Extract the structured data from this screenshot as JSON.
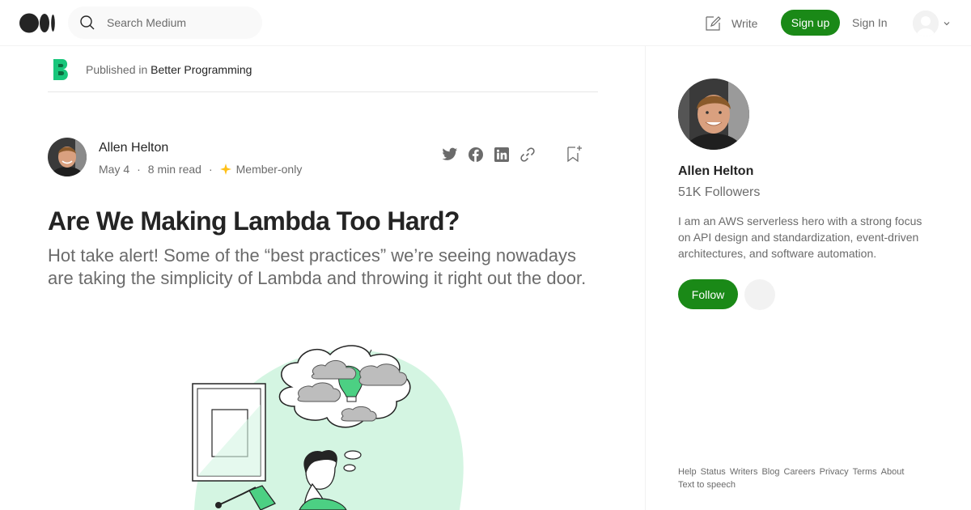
{
  "header": {
    "search_placeholder": "Search Medium",
    "write_label": "Write",
    "signup_label": "Sign up",
    "signin_label": "Sign In"
  },
  "publication": {
    "prefix": "Published in ",
    "name": "Better Programming"
  },
  "article": {
    "author": "Allen Helton",
    "date": "May 4",
    "read_time": "8 min read",
    "member_label": "Member-only",
    "title": "Are We Making Lambda Too Hard?",
    "subtitle": "Hot take alert! Some of the “best practices” we’re seeing nowadays are taking the simplicity of Lambda and throwing it right out the door."
  },
  "sidebar": {
    "name": "Allen Helton",
    "followers": "51K Followers",
    "bio": "I am an AWS serverless hero with a strong focus on API design and standardization, event-driven architectures, and software automation.",
    "follow_label": "Follow"
  },
  "footer": {
    "links": [
      "Help",
      "Status",
      "Writers",
      "Blog",
      "Careers",
      "Privacy",
      "Terms",
      "About",
      "Text to speech"
    ]
  },
  "colors": {
    "accent": "#1a8917",
    "text_primary": "#242424",
    "text_secondary": "#6b6b6b",
    "illustration_mint": "#d4f5e2"
  },
  "icons": {
    "logo": "medium-logo-icon",
    "search": "search-icon",
    "write": "write-icon",
    "twitter": "twitter-icon",
    "facebook": "facebook-icon",
    "linkedin": "linkedin-icon",
    "link": "link-icon",
    "bookmark": "bookmark-add-icon",
    "member": "star-icon"
  }
}
